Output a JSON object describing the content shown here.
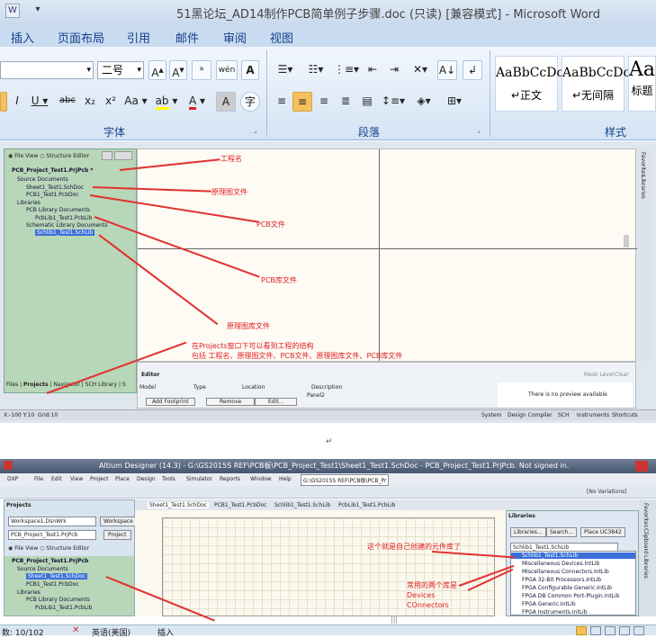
{
  "word": {
    "title": "51黑论坛_AD14制作PCB简单例子步骤.doc (只读) [兼容模式] - Microsoft Word",
    "tabs": [
      "插入",
      "页面布局",
      "引用",
      "邮件",
      "审阅",
      "视图"
    ],
    "font_size": "二号",
    "groups": {
      "font": "字体",
      "paragraph": "段落",
      "styles": "样式"
    },
    "styles": [
      {
        "sample": "AaBbCcDc",
        "name": "↵正文"
      },
      {
        "sample": "AaBbCcDc",
        "name": "↵无间隔"
      },
      {
        "sample": "AaI",
        "name": "标题"
      }
    ],
    "status": {
      "page": "数: 10/102",
      "lang": "英语(美国)",
      "mode": "插入"
    },
    "para_mark": "↵"
  },
  "ad1": {
    "view_modes": [
      "File View",
      "Structure Editor"
    ],
    "tree": [
      "PCB_Project_Test1.PrjPcb *",
      "Source Documents",
      "Sheet1_Test1.SchDoc",
      "PCB1_Test1.PcbDoc",
      "Libraries",
      "PCB Library Documents",
      "PcbLib1_Test1.PcbLib",
      "Schematic Library Documents",
      "Schlib1_Test1.SchLib"
    ],
    "annotations": [
      "工程名",
      "原理图文件",
      "PCB文件",
      "PCB库文件",
      "原理图库文件",
      "在Projects窗口下可以看到工程的结构",
      "包括 工程名、原理图文件、PCB文件、原理图库文件、PCB库文件"
    ],
    "panel_tabs": [
      "Files",
      "Projects",
      "Navigator",
      "SCH Library",
      "S"
    ],
    "editor": {
      "title": "Editor",
      "cols": [
        "Model",
        "Type",
        "Location",
        "Description"
      ],
      "panel": "Panel2",
      "buttons": [
        "Add Footprint",
        "Remove",
        "Edit..."
      ],
      "preview": "There is no preview available",
      "mask": "Mask Level",
      "clear": "Clear"
    },
    "status": {
      "coords": "X:-100 Y:10",
      "grid": "Grid:10",
      "items": [
        "System",
        "Design Compiler",
        "SCH",
        "Instruments",
        "Shortcuts"
      ]
    },
    "side_tabs": [
      "Favorites",
      "Libraries"
    ]
  },
  "ad2": {
    "title": "Altium Designer (14.3) - G:\\GS2015S REF\\PCB板\\PCB_Project_Test1\\Sheet1_Test1.SchDoc - PCB_Project_Test1.PrjPcb. Not signed in.",
    "menu": [
      "DXP",
      "File",
      "Edit",
      "View",
      "Project",
      "Place",
      "Design",
      "Tools",
      "Simulator",
      "Reports",
      "Window",
      "Help"
    ],
    "path_box": "G:\\GS2015S REF\\PCB板\\PCB_Pr",
    "variations": "[No Variations]",
    "doc_tabs": [
      "Sheet1_Test1.SchDoc",
      "PCB1_Test1.PcbDoc",
      "Schlib1_Test1.SchLib",
      "PcbLib1_Test1.PcbLib"
    ],
    "projects": {
      "title": "Projects",
      "workspace": "Workspace1.DsnWrk",
      "workspace_btn": "Workspace",
      "project": "PCB_Project_Test1.PrjPcb",
      "project_btn": "Project",
      "tree": [
        "PCB_Project_Test1.PrjPcb",
        "Source Documents",
        "Sheet1_Test1.SchDoc",
        "PCB1_Test1.PcbDoc",
        "Libraries",
        "PCB Library Documents",
        "PcbLib1_Test1.PcbLib"
      ]
    },
    "libraries": {
      "title": "Libraries",
      "buttons": [
        "Libraries...",
        "Search...",
        "Place UC3842"
      ],
      "selected": "Schlib1_Test1.SchLib",
      "items": [
        "Schlib1_Test1.SchLib",
        "Miscellaneous Devices.IntLib",
        "Miscellaneous Connectors.IntLib",
        "FPGA 32-Bit Processors.IntLib",
        "FPGA Configurable Generic.IntLib",
        "FPGA DB Common Port-Plugin.IntLib",
        "FPGA Generic.IntLib",
        "FPGA Instruments.IntLib"
      ]
    },
    "annotations": [
      "这个就是自己创建的元件库了",
      "常用的两个库是",
      "Devices",
      "COnnectors"
    ],
    "side_tabs": [
      "Favorites",
      "Clipboard",
      "Libraries"
    ]
  },
  "colors": {
    "annotation": "#e02020",
    "arrow": "#e23030",
    "ribbon_text": "#15428b"
  }
}
